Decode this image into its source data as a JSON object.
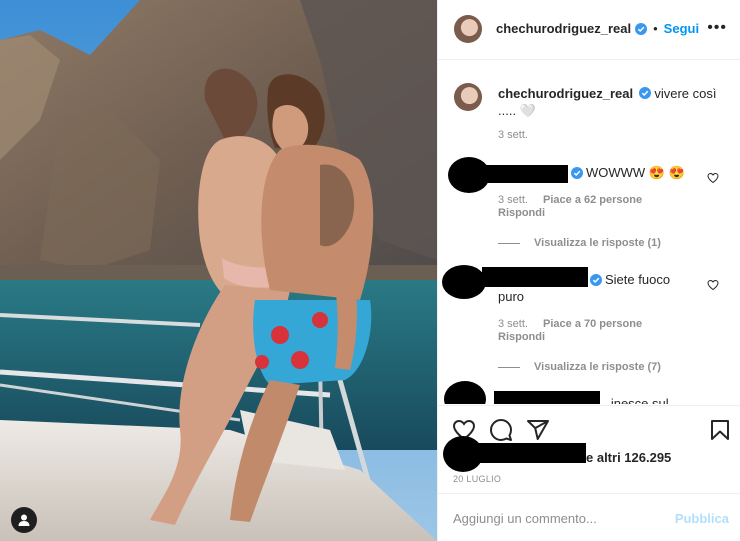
{
  "post": {
    "username": "chechurodriguez_real",
    "follow_label": "Segui",
    "dot": "•",
    "more_label": "•••"
  },
  "caption": {
    "username": "chechurodriguez_real",
    "text": "vivere così ..... 🤍",
    "age": "3 sett."
  },
  "comments": [
    {
      "text": "WOWWW 😍 😍",
      "age": "3 sett.",
      "likes": "Piace a 62 persone",
      "reply_label": "Rispondi",
      "view_replies": "Visualizza le risposte (1)"
    },
    {
      "text": "Siete fuoco puro",
      "age": "3 sett.",
      "likes": "Piace a 70 persone",
      "reply_label": "Rispondi",
      "view_replies": "Visualizza le risposte (7)"
    },
    {
      "text": "...inesce sul"
    }
  ],
  "actions": {
    "likes_text": "e altri 126.295",
    "date": "20 LUGLIO",
    "icons": [
      "heart-icon",
      "comment-icon",
      "share-icon",
      "bookmark-icon"
    ]
  },
  "add_comment": {
    "placeholder": "Aggiungi un commento...",
    "post_label": "Pubblica"
  },
  "colors": {
    "accent": "#0095f6",
    "muted": "#8e8e8e",
    "post_disabled": "#b2dffc"
  }
}
